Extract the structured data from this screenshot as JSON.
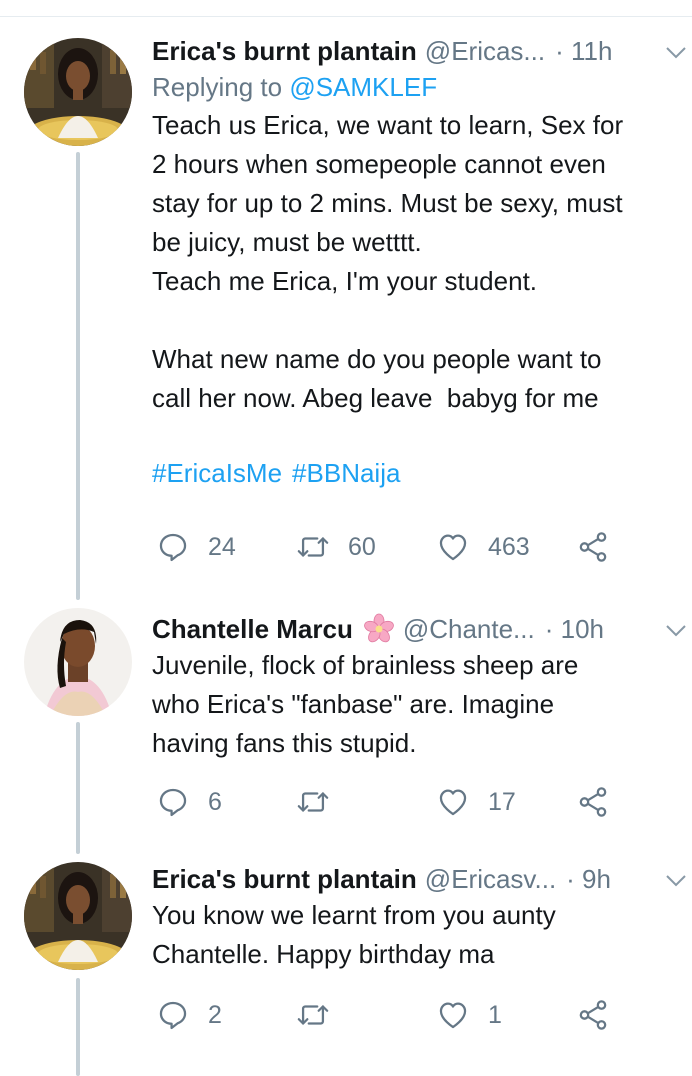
{
  "tweets": [
    {
      "name": "Erica's burnt plantain",
      "handle": "@Ericas...",
      "time": "· 11h",
      "replying_label": "Replying to",
      "replying_to": "@SAMKLEF",
      "text": "Teach us Erica, we want to learn, Sex for\n2 hours when somepeople cannot even\nstay for up to 2 mins. Must be sexy, must\nbe juicy, must be wetttt.\nTeach me Erica, I'm your student.\n\nWhat new name do you people want to\ncall her now. Abeg leave  babyg for me",
      "hashtags": [
        "#EricaIsMe",
        "#BBNaija"
      ],
      "replies": "24",
      "retweets": "60",
      "likes": "463"
    },
    {
      "name": "Chantelle Marcu",
      "name_emoji": "cherry-blossom-icon",
      "handle": "@Chante...",
      "time": "· 10h",
      "text": "Juvenile, flock of brainless sheep are\nwho Erica's \"fanbase\" are. Imagine\nhaving fans this stupid.",
      "replies": "6",
      "retweets": "",
      "likes": "17"
    },
    {
      "name": "Erica's burnt plantain",
      "handle": "@Ericasv...",
      "time": "· 9h",
      "text": "You know we learnt from you aunty\nChantelle. Happy birthday ma",
      "replies": "2",
      "retweets": "",
      "likes": "1"
    }
  ],
  "icons": {
    "reply": "reply-icon",
    "retweet": "retweet-icon",
    "like": "heart-icon",
    "share": "share-icon",
    "caret": "chevron-down-icon"
  },
  "colors": {
    "link": "#1da1f2",
    "secondary": "#657786",
    "thread_line": "#c4cfd6",
    "divider": "#e6ecf0"
  }
}
